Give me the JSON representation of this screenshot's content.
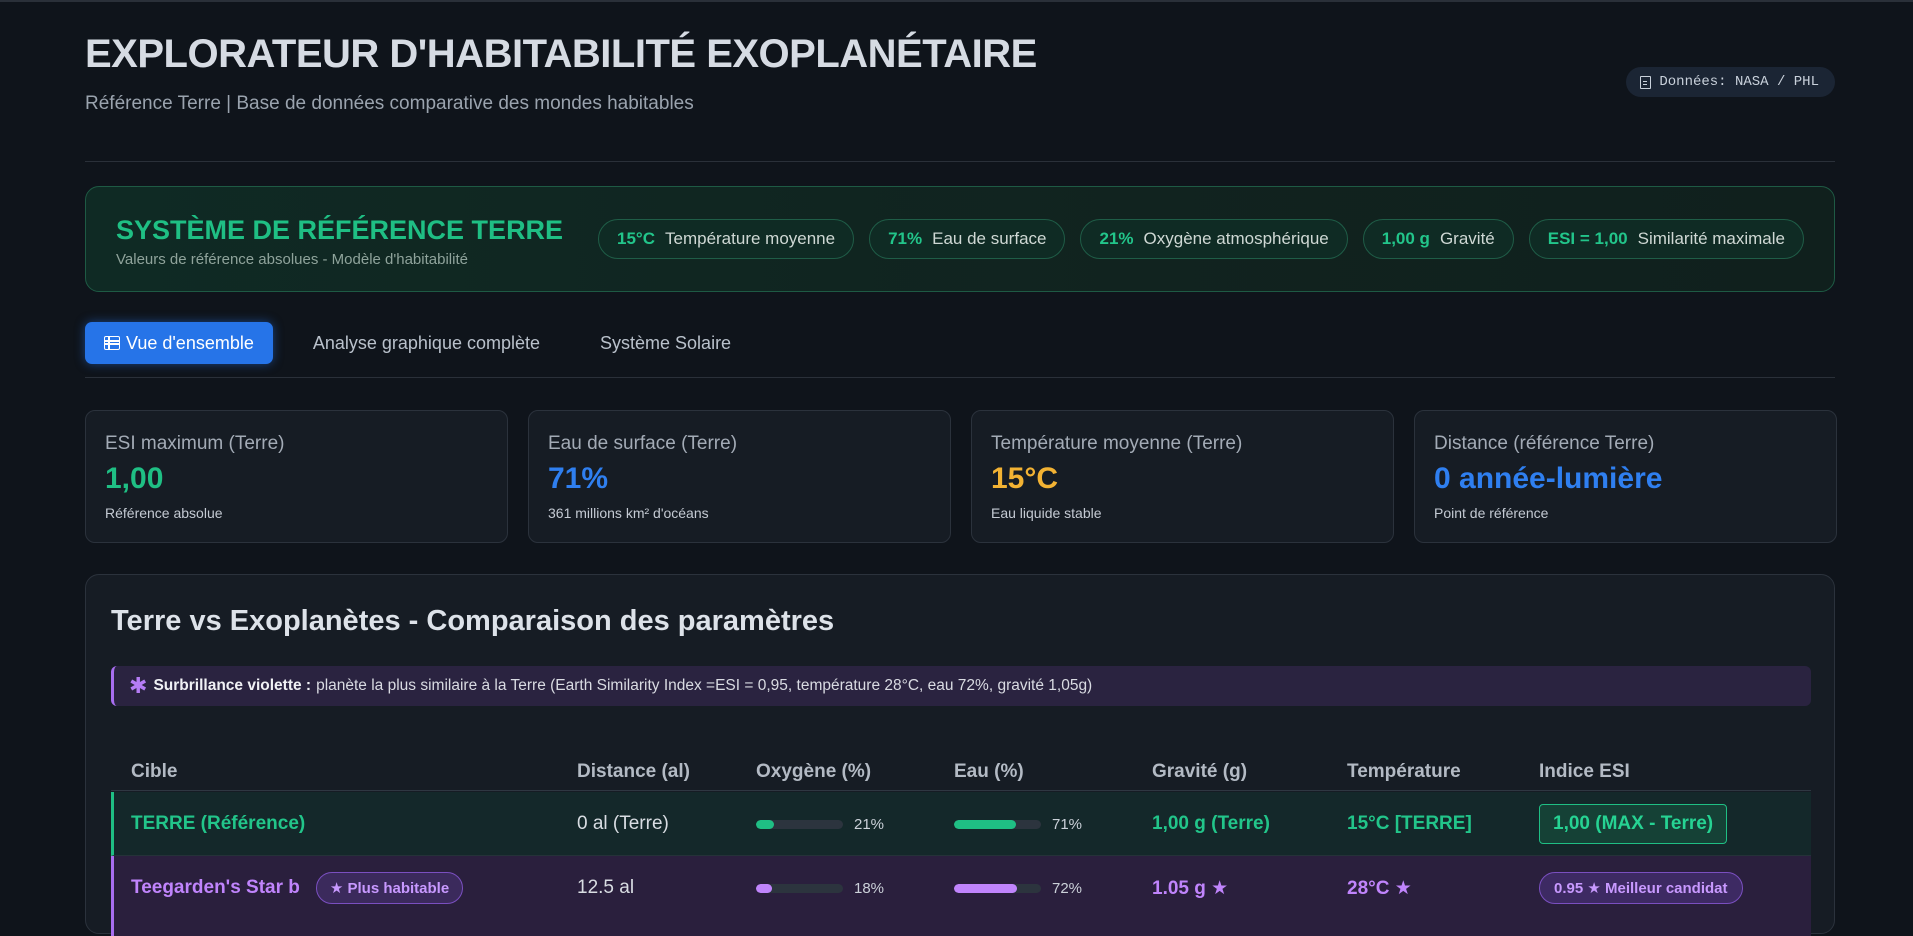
{
  "header": {
    "title": "EXPLORATEUR D'HABITABILITÉ EXOPLANÉTAIRE",
    "subtitle": "Référence Terre | Base de données comparative des mondes habitables",
    "source_label": "Données: NASA / PHL",
    "source_icon": "document-icon"
  },
  "reference_system": {
    "title": "SYSTÈME DE RÉFÉRENCE TERRE",
    "subtitle": "Valeurs de référence absolues - Modèle d'habitabilité",
    "chips": [
      {
        "value": "15°C",
        "label": "Température moyenne"
      },
      {
        "value": "71%",
        "label": "Eau de surface"
      },
      {
        "value": "21%",
        "label": "Oxygène atmosphérique"
      },
      {
        "value": "1,00 g",
        "label": "Gravité"
      },
      {
        "value": "ESI = 1,00",
        "label": "Similarité maximale"
      }
    ]
  },
  "tabs": [
    {
      "label": "Vue d'ensemble",
      "active": true,
      "icon": "table-icon"
    },
    {
      "label": "Analyse graphique complète",
      "active": false
    },
    {
      "label": "Système Solaire",
      "active": false
    }
  ],
  "cards": [
    {
      "label": "ESI maximum (Terre)",
      "value": "1,00",
      "note": "Référence absolue",
      "color": "#1fbf84"
    },
    {
      "label": "Eau de surface (Terre)",
      "value": "71%",
      "note": "361 millions km² d'océans",
      "color": "#2f7ff0"
    },
    {
      "label": "Température moyenne (Terre)",
      "value": "15°C",
      "note": "Eau liquide stable",
      "color": "#f2b233"
    },
    {
      "label": "Distance (référence Terre)",
      "value": "0 année-lumière",
      "note": "Point de référence",
      "color": "#2f7ff0"
    }
  ],
  "comparison": {
    "title": "Terre vs Exoplanètes - Comparaison des paramètres",
    "note_star": "✱",
    "note_bold": "Surbrillance violette :",
    "note_text": "planète la plus similaire à la Terre (Earth Similarity Index =ESI = 0,95, température 28°C, eau 72%, gravité 1,05g)",
    "columns": [
      "Cible",
      "Distance (al)",
      "Oxygène (%)",
      "Eau (%)",
      "Gravité (g)",
      "Température",
      "Indice ESI"
    ],
    "rows": [
      {
        "name": "TERRE (Référence)",
        "distance": "0 al (Terre)",
        "oxygen": 21,
        "oxygen_label": "21%",
        "water": 71,
        "water_label": "71%",
        "gravity": "1,00 g (Terre)",
        "temperature": "15°C [TERRE]",
        "esi": "1,00 (MAX - Terre)"
      },
      {
        "name": "Teegarden's Star b",
        "badge": "★ Plus habitable",
        "distance": "12.5 al",
        "oxygen": 18,
        "oxygen_label": "18%",
        "water": 72,
        "water_label": "72%",
        "gravity": "1.05 g ★",
        "temperature": "28°C ★",
        "esi": "0.95 ★ Meilleur candidat"
      }
    ]
  },
  "colors": {
    "earth_accent": "#1fbf84",
    "highlight_violet": "#a86ef0",
    "primary_blue": "#2674e8"
  }
}
